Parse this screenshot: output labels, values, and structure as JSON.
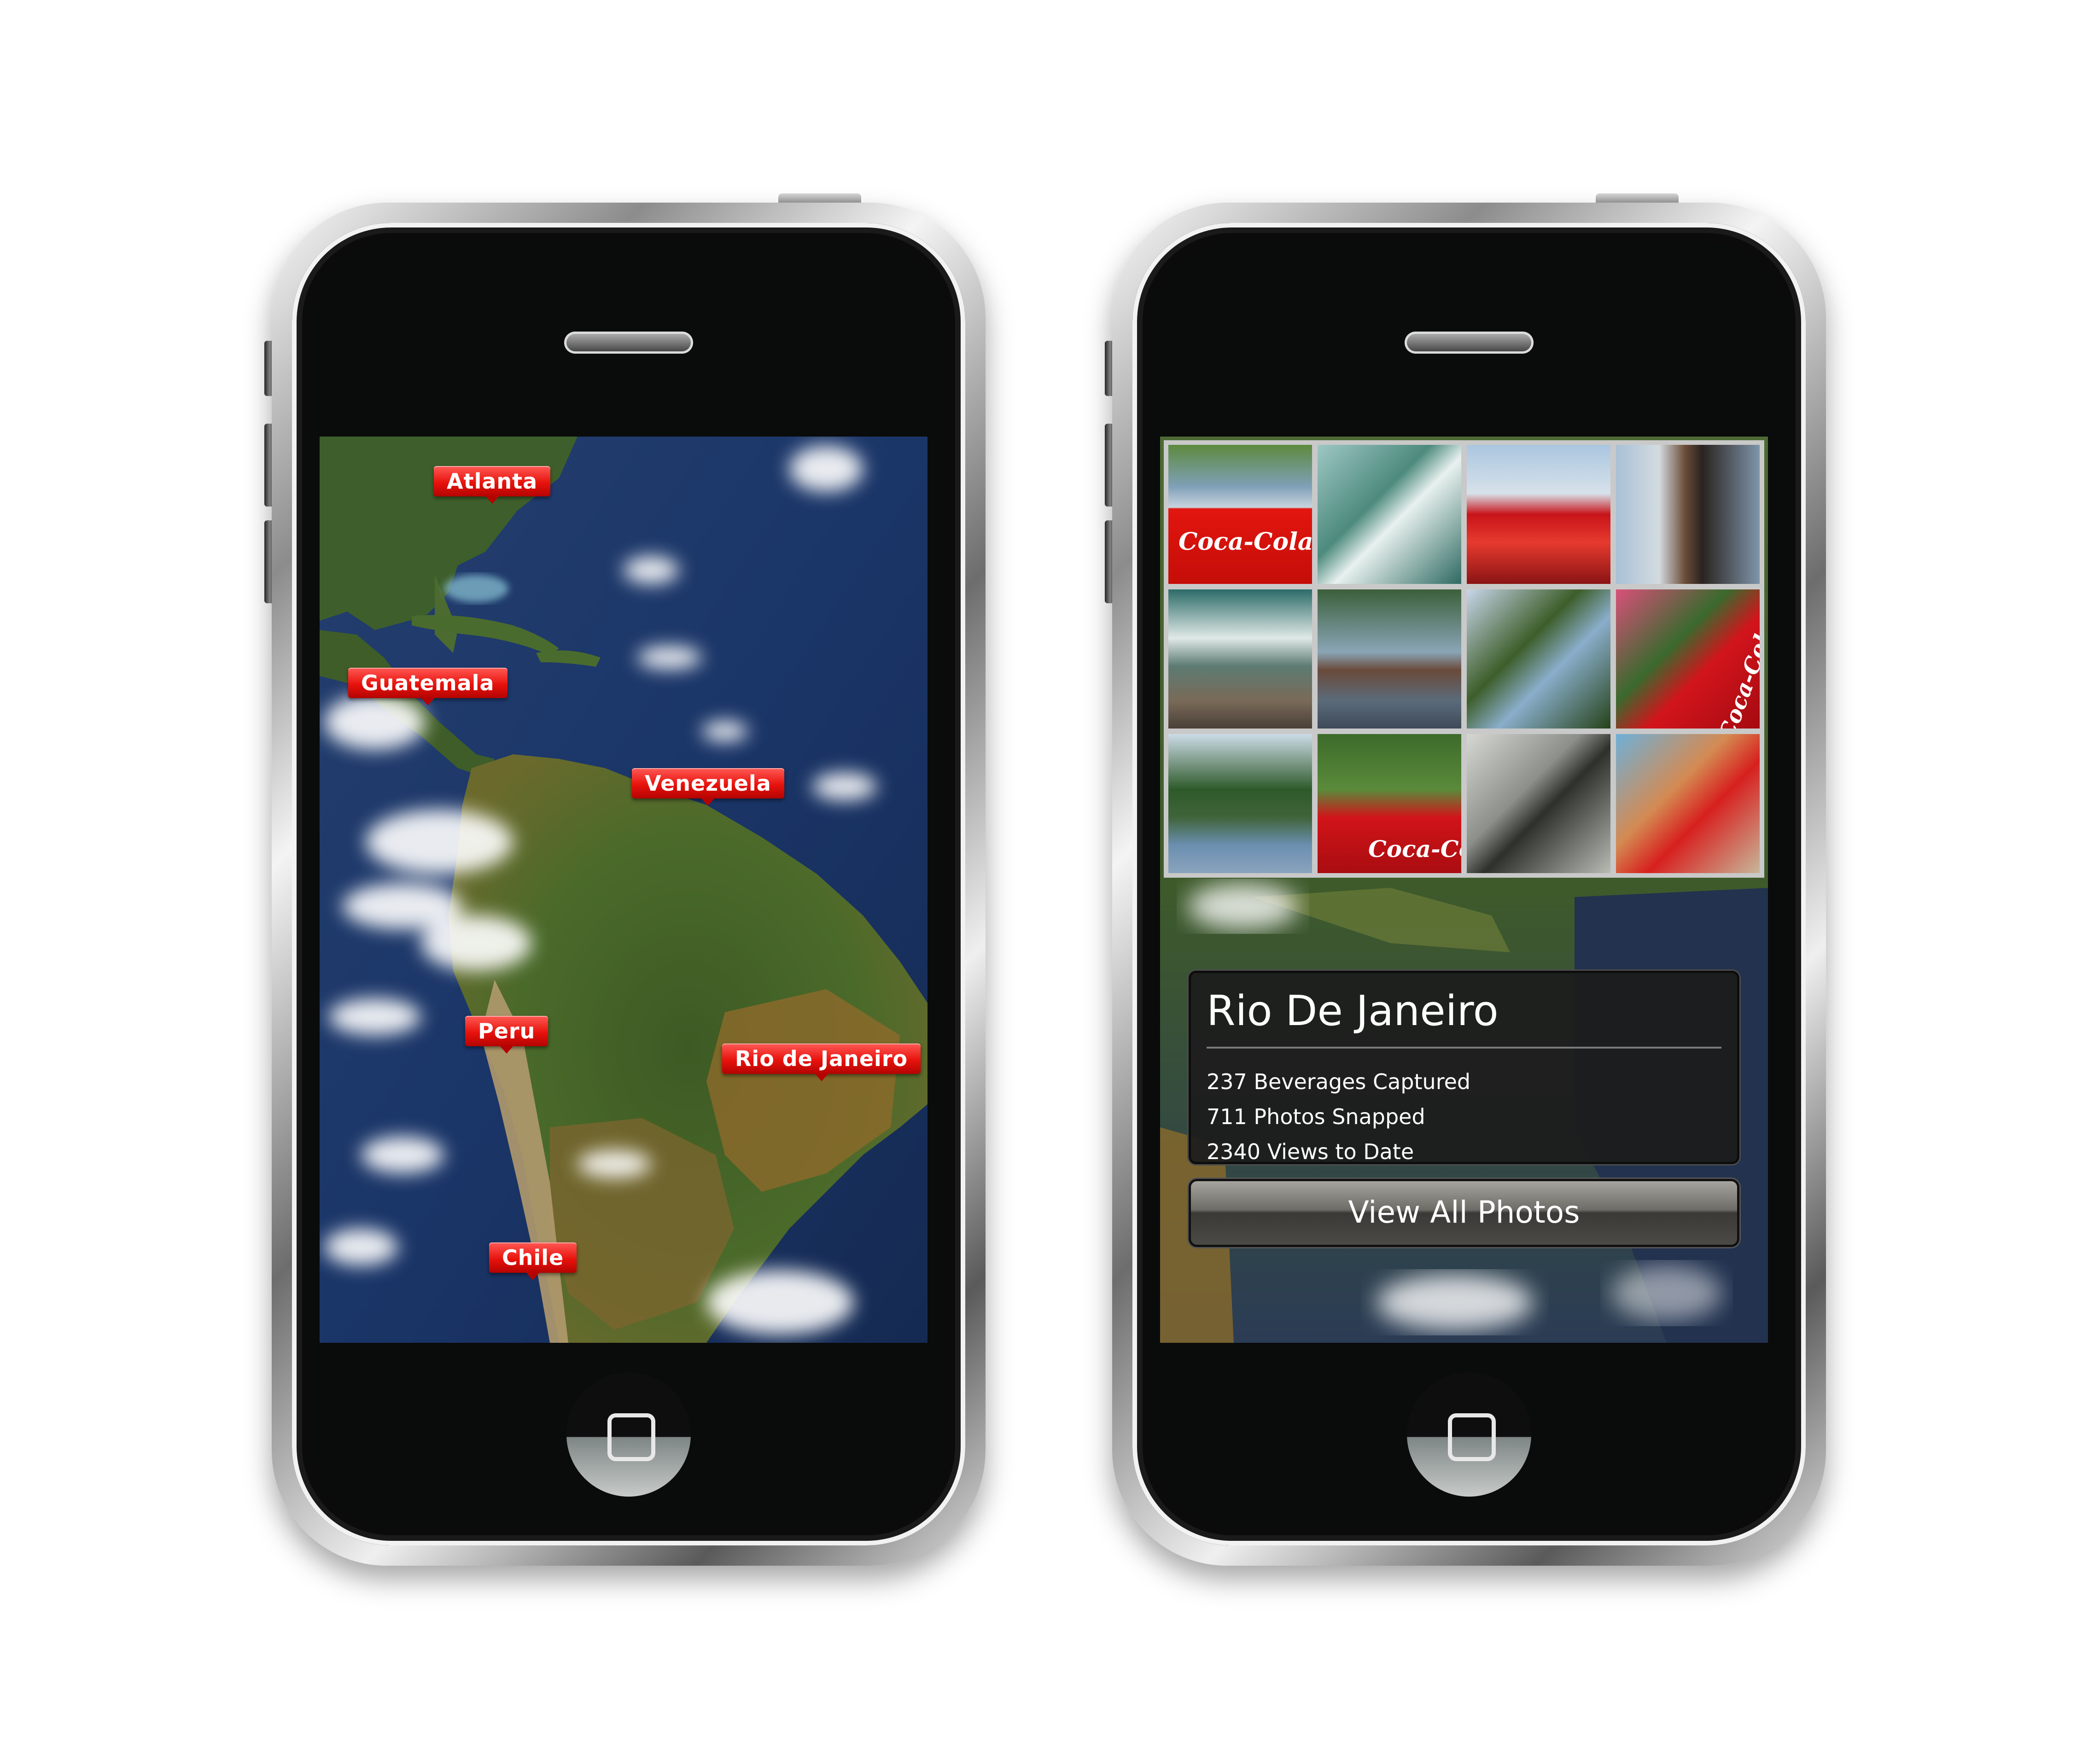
{
  "left_phone": {
    "map_tags": [
      {
        "label": "Atlanta"
      },
      {
        "label": "Guatemala"
      },
      {
        "label": "Venezuela"
      },
      {
        "label": "Peru"
      },
      {
        "label": "Rio de Janeiro"
      },
      {
        "label": "Chile"
      }
    ]
  },
  "right_phone": {
    "photo_brand_text": "Coca-Cola",
    "city": {
      "title": "Rio De Janeiro",
      "stats": [
        "237 Beverages Captured",
        "711 Photos Snapped",
        "2340 Views to Date"
      ]
    },
    "view_button_label": "View All Photos"
  },
  "colors": {
    "tag_red": "#e8120c",
    "panel_dark": "#1c1c1c",
    "ocean_blue": "#1b3a6e",
    "land_green": "#3f5a2a"
  },
  "icons": [
    "speaker-grille",
    "home-button-square-icon"
  ]
}
